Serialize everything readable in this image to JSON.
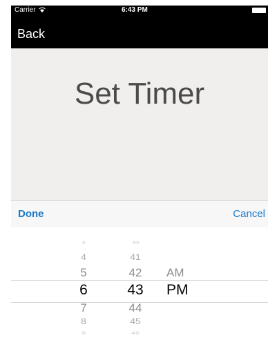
{
  "status_bar": {
    "carrier": "Carrier",
    "time": "6:43 PM"
  },
  "nav": {
    "back_label": "Back"
  },
  "main": {
    "title": "Set Timer"
  },
  "toolbar": {
    "done_label": "Done",
    "cancel_label": "Cancel"
  },
  "picker": {
    "hours": [
      "3",
      "4",
      "5",
      "6",
      "7",
      "8",
      "9"
    ],
    "minutes": [
      "40",
      "41",
      "42",
      "43",
      "44",
      "45",
      "46"
    ],
    "ampm": [
      "AM",
      "PM"
    ],
    "selected": {
      "hour": "6",
      "minute": "43",
      "ampm": "PM"
    }
  }
}
